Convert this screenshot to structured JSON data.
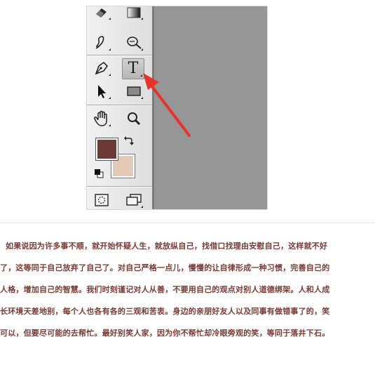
{
  "toolbar": {
    "type_tool_glyph": "T"
  },
  "colors": {
    "foreground": "#6b3a36",
    "background": "#e2c9b8",
    "annotation_arrow": "#e8322c",
    "text": "#7a3b34"
  },
  "icons": [
    "eraser-icon",
    "gradient-icon",
    "blur-icon",
    "dodge-icon",
    "pen-icon",
    "type-icon",
    "move-selection-icon",
    "rectangle-shape-icon",
    "hand-icon",
    "zoom-icon",
    "swap-colors-icon",
    "default-colors-icon",
    "quick-mask-icon",
    "screen-mode-icon"
  ],
  "article": {
    "lines": [
      "如果说因为许多事不顺，就开始怀疑人生，就放纵自己，找借口找理由安慰自己，这样就不好",
      "了，这等同于自己放弃了自己了。对自己严格一点儿，慢慢的让自律形成一种习惯，完善自己的",
      "人格，增加自己的智慧。我们时刻谨记对人从善，不要用自己的观点对别人道德绑架。人和人成",
      "长环境天差地别，每个人也各有各的三观和苦衷。身边的亲朋好友人以及同事有做错事了的，笑",
      "可以，但要尽可能的去帮忙。最好别笑人家，因为你不帮忙却冷眼旁观的笑，等同于落井下石。"
    ]
  }
}
